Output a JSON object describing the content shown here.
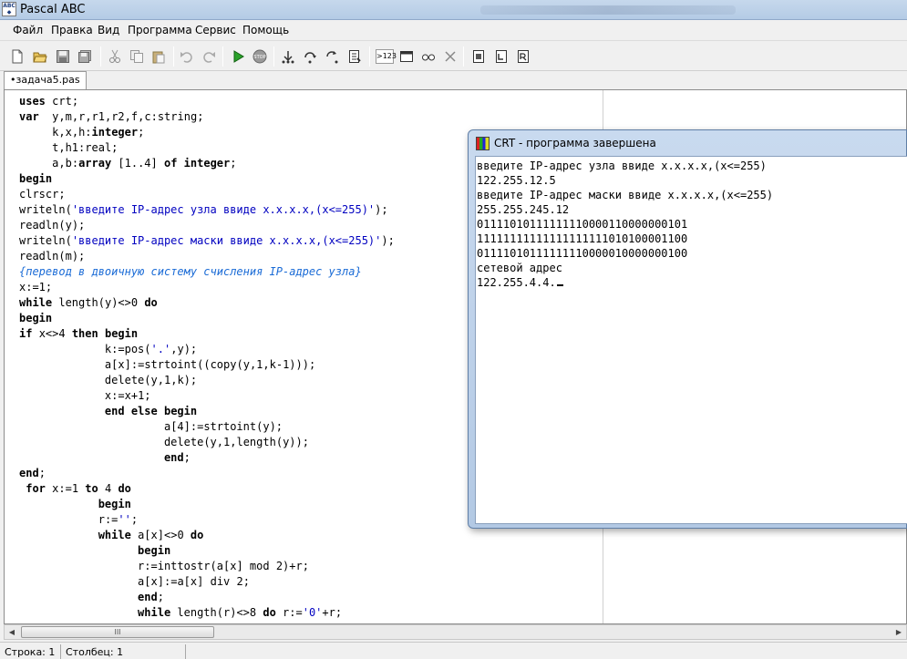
{
  "window": {
    "title": "Pascal ABC"
  },
  "menu": [
    "Файл",
    "Правка",
    "Вид",
    "Программа",
    "Сервис",
    "Помощь"
  ],
  "toolbar": {
    "icons": [
      "new-file-icon",
      "open-folder-icon",
      "save-icon",
      "save-all-icon",
      "cut-icon",
      "copy-icon",
      "paste-icon",
      "undo-icon",
      "redo-icon",
      "run-icon",
      "stop-icon",
      "step-into-icon",
      "step-over-icon",
      "step-out-icon",
      "watch-icon",
      "output-toggle-icon",
      "window-icon",
      "glasses-icon",
      "close-x-icon",
      "doc-icon-1",
      "doc-icon-2",
      "doc-icon-3"
    ],
    "output_label": ">123",
    "stop_label": "STOP"
  },
  "tab": {
    "label": "•задача5.pas"
  },
  "editor": {
    "lines": [
      "uses crt;",
      "var  y,m,r,r1,r2,f,c:string;",
      "     k,x,h:integer;",
      "     t,h1:real;",
      "     a,b:array [1..4] of integer;",
      "begin",
      "clrscr;",
      "writeln('введите IP-адрес узла ввиде x.x.x.x,(x<=255)');",
      "readln(y);",
      "writeln('введите IP-адрес маски ввиде x.x.x.x,(x<=255)');",
      "readln(m);",
      "{перевод в двоичную систему счисления IP-адрес узла}",
      "x:=1;",
      "while length(y)<>0 do",
      "begin",
      "if x<>4 then begin",
      "             k:=pos('.',y);",
      "             a[x]:=strtoint((copy(y,1,k-1)));",
      "             delete(y,1,k);",
      "             x:=x+1;",
      "             end else begin",
      "                      a[4]:=strtoint(y);",
      "                      delete(y,1,length(y));",
      "                      end;",
      "end;",
      " for x:=1 to 4 do",
      "            begin",
      "            r:='';",
      "            while a[x]<>0 do",
      "                  begin",
      "                  r:=inttostr(a[x] mod 2)+r;",
      "                  a[x]:=a[x] div 2;",
      "                  end;",
      "                  while length(r)<>8 do r:='0'+r;"
    ]
  },
  "crt": {
    "title": "CRT - программа завершена",
    "lines": [
      "введите IP-адрес узла ввиде x.x.x.x,(x<=255)",
      "122.255.12.5",
      "введите IP-адрес маски ввиде x.x.x.x,(x<=255)",
      "255.255.245.12",
      "01111010111111110000110000000101",
      "11111111111111111111010100001100",
      "01111010111111110000010000000100",
      "сетевой адрес",
      "122.255.4.4."
    ]
  },
  "scrollbar": {
    "grip": "III"
  },
  "status": {
    "row": "Строка: 1",
    "col": "Столбец: 1"
  }
}
